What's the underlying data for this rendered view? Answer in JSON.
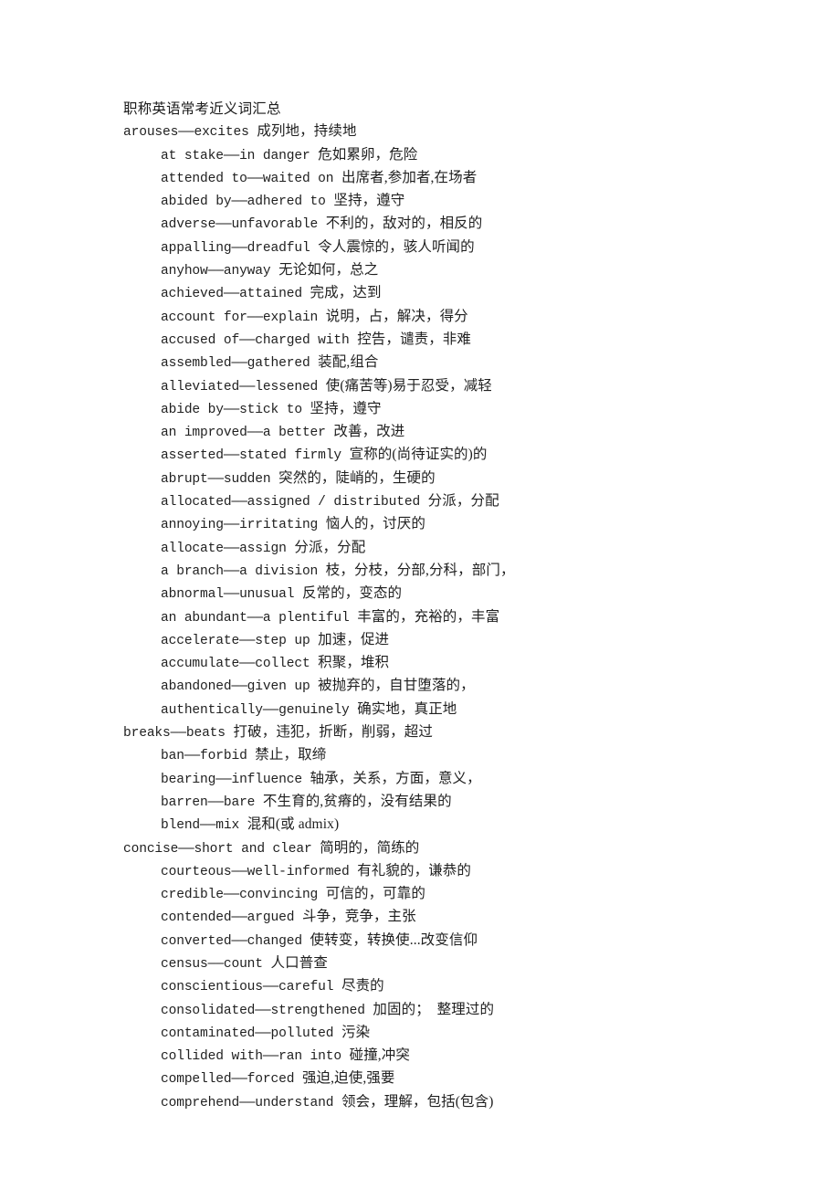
{
  "document": {
    "title": "职称英语常考近义词汇总",
    "background_color": "#ffffff",
    "text_color": "#1f1f1f",
    "entries": [
      {
        "level": "head",
        "latin": "arouses——excites ",
        "cjk": "成列地，持续地"
      },
      {
        "level": "sub",
        "latin": "at stake——in danger ",
        "cjk": "危如累卵，危险"
      },
      {
        "level": "sub",
        "latin": "attended to——waited on ",
        "cjk": "出席者,参加者,在场者"
      },
      {
        "level": "sub",
        "latin": "abided by——adhered to ",
        "cjk": "坚持，遵守"
      },
      {
        "level": "sub",
        "latin": "adverse——unfavorable ",
        "cjk": "不利的，敌对的，相反的"
      },
      {
        "level": "sub",
        "latin": "appalling——dreadful ",
        "cjk": "令人震惊的，骇人听闻的"
      },
      {
        "level": "sub",
        "latin": "anyhow——anyway ",
        "cjk": "无论如何，总之"
      },
      {
        "level": "sub",
        "latin": "achieved——attained ",
        "cjk": "完成，达到"
      },
      {
        "level": "sub",
        "latin": "account for——explain ",
        "cjk": "说明，占，解决，得分"
      },
      {
        "level": "sub",
        "latin": "accused of——charged with ",
        "cjk": "控告，谴责，非难"
      },
      {
        "level": "sub",
        "latin": "assembled——gathered ",
        "cjk": "装配,组合"
      },
      {
        "level": "sub",
        "latin": "alleviated——lessened ",
        "cjk": "使(痛苦等)易于忍受，减轻"
      },
      {
        "level": "sub",
        "latin": "abide by——stick to ",
        "cjk": "坚持，遵守"
      },
      {
        "level": "sub",
        "latin": "an improved——a better ",
        "cjk": "改善，改进"
      },
      {
        "level": "sub",
        "latin": "asserted——stated firmly ",
        "cjk": "宣称的(尚待证实的)的"
      },
      {
        "level": "sub",
        "latin": "abrupt——sudden ",
        "cjk": "突然的，陡峭的，生硬的"
      },
      {
        "level": "sub",
        "latin": "allocated——assigned / distributed ",
        "cjk": "分派，分配"
      },
      {
        "level": "sub",
        "latin": "annoying——irritating ",
        "cjk": "恼人的，讨厌的"
      },
      {
        "level": "sub",
        "latin": "allocate——assign ",
        "cjk": "分派，分配"
      },
      {
        "level": "sub",
        "latin": "a branch——a division ",
        "cjk": "枝，分枝，分部,分科，部门，"
      },
      {
        "level": "sub",
        "latin": "abnormal——unusual ",
        "cjk": "反常的，变态的"
      },
      {
        "level": "sub",
        "latin": "an abundant——a plentiful ",
        "cjk": "丰富的，充裕的，丰富"
      },
      {
        "level": "sub",
        "latin": "accelerate——step up ",
        "cjk": "加速，促进"
      },
      {
        "level": "sub",
        "latin": "accumulate——collect ",
        "cjk": "积聚，堆积"
      },
      {
        "level": "sub",
        "latin": "abandoned——given up ",
        "cjk": "被抛弃的，自甘堕落的，"
      },
      {
        "level": "sub",
        "latin": "authentically——genuinely ",
        "cjk": "确实地，真正地"
      },
      {
        "level": "head",
        "latin": "breaks——beats ",
        "cjk": "打破，违犯，折断，削弱，超过"
      },
      {
        "level": "sub",
        "latin": "ban——forbid ",
        "cjk": "禁止，取缔"
      },
      {
        "level": "sub",
        "latin": "bearing——influence ",
        "cjk": "轴承，关系，方面，意义，"
      },
      {
        "level": "sub",
        "latin": "barren——bare ",
        "cjk": "不生育的,贫瘠的，没有结果的"
      },
      {
        "level": "sub",
        "latin": "blend——mix ",
        "cjk": "混和(或 admix)"
      },
      {
        "level": "head",
        "latin": "concise——short and clear ",
        "cjk": "简明的，简练的"
      },
      {
        "level": "sub",
        "latin": "courteous——well-informed ",
        "cjk": "有礼貌的，谦恭的"
      },
      {
        "level": "sub",
        "latin": "credible——convincing ",
        "cjk": "可信的，可靠的"
      },
      {
        "level": "sub",
        "latin": "contended——argued ",
        "cjk": "斗争，竞争，主张"
      },
      {
        "level": "sub",
        "latin": "converted——changed ",
        "cjk": "使转变，转换使...改变信仰"
      },
      {
        "level": "sub",
        "latin": "census——count ",
        "cjk": "人口普查"
      },
      {
        "level": "sub",
        "latin": "conscientious——careful ",
        "cjk": "尽责的"
      },
      {
        "level": "sub",
        "latin": "consolidated——strengthened ",
        "cjk": "加固的；　整理过的"
      },
      {
        "level": "sub",
        "latin": "contaminated——polluted ",
        "cjk": "污染"
      },
      {
        "level": "sub",
        "latin": "collided with——ran into ",
        "cjk": "碰撞,冲突"
      },
      {
        "level": "sub",
        "latin": "compelled——forced ",
        "cjk": "强迫,迫使,强要"
      },
      {
        "level": "sub",
        "latin": "comprehend——understand ",
        "cjk": "领会，理解，包括(包含)"
      }
    ]
  }
}
